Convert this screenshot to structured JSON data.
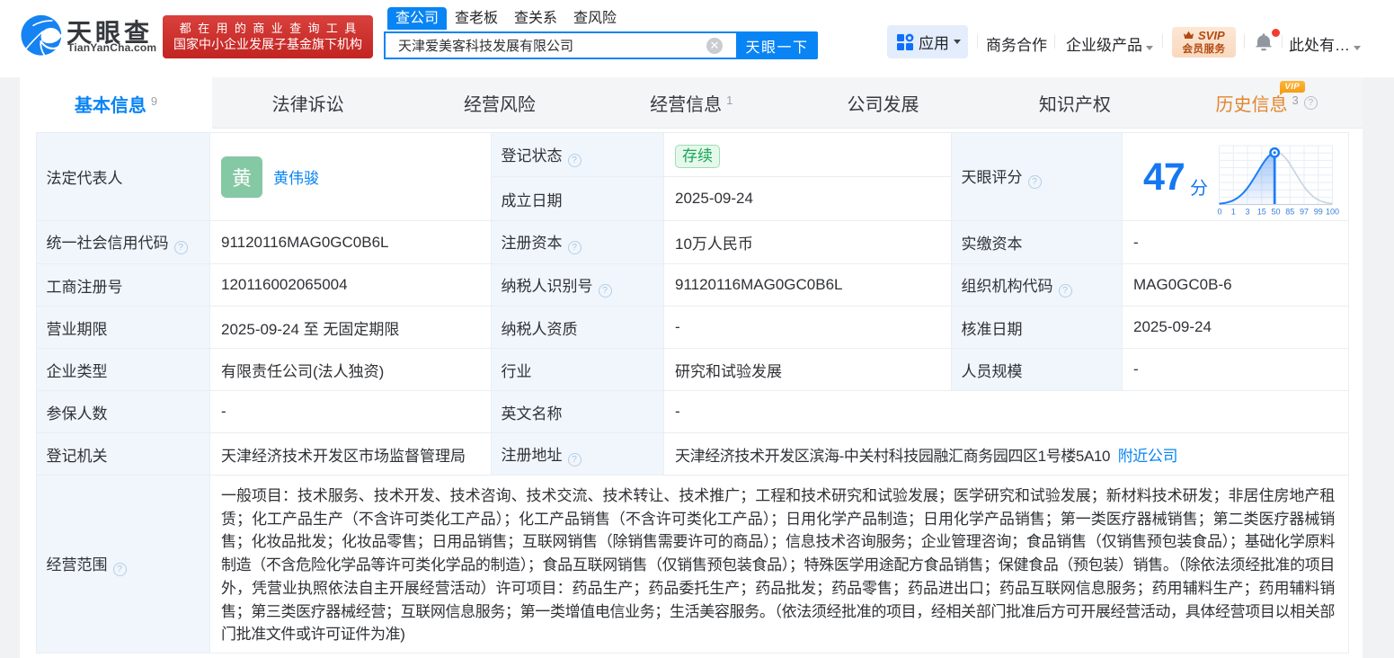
{
  "header": {
    "brand_cn": "天眼查",
    "brand_domain": "TianYanCha.com",
    "slogan_line1": "都在用的商业查询工具",
    "slogan_line2": "国家中小企业发展子基金旗下机构",
    "search": {
      "tabs": [
        {
          "label": "查公司"
        },
        {
          "label": "查老板"
        },
        {
          "label": "查关系"
        },
        {
          "label": "查风险"
        }
      ],
      "value": "天津爱美客科技发展有限公司",
      "button_label": "天眼一下"
    },
    "nav": {
      "apps": "应用",
      "business_coop": "商务合作",
      "enterprise_products": "企业级产品",
      "svip_line1": "SVIP",
      "svip_line2": "会员服务",
      "user": "此处有…"
    }
  },
  "tabs": [
    {
      "label": "基本信息",
      "count": "9"
    },
    {
      "label": "法律诉讼",
      "count": ""
    },
    {
      "label": "经营风险",
      "count": ""
    },
    {
      "label": "经营信息",
      "count": "1"
    },
    {
      "label": "公司发展",
      "count": ""
    },
    {
      "label": "知识产权",
      "count": ""
    },
    {
      "label": "历史信息",
      "count": "3",
      "vip": "VIP"
    }
  ],
  "info": {
    "legal_rep_label": "法定代表人",
    "legal_rep_avatar": "黄",
    "legal_rep_name": "黄伟骏",
    "reg_status_label": "登记状态",
    "reg_status": "存续",
    "est_date_label": "成立日期",
    "est_date": "2025-09-24",
    "score_label": "天眼评分",
    "score": "47",
    "score_unit": "分",
    "uscc_label": "统一社会信用代码",
    "uscc": "91120116MAG0GC0B6L",
    "reg_capital_label": "注册资本",
    "reg_capital": "10万人民币",
    "paid_capital_label": "实缴资本",
    "paid_capital": "-",
    "reg_no_label": "工商注册号",
    "reg_no": "120116002065004",
    "taxpayer_id_label": "纳税人识别号",
    "taxpayer_id": "91120116MAG0GC0B6L",
    "org_code_label": "组织机构代码",
    "org_code": "MAG0GC0B-6",
    "term_label": "营业期限",
    "term": "2025-09-24 至 无固定期限",
    "taxpayer_quality_label": "纳税人资质",
    "taxpayer_quality": "-",
    "approval_date_label": "核准日期",
    "approval_date": "2025-09-24",
    "company_type_label": "企业类型",
    "company_type": "有限责任公司(法人独资)",
    "industry_label": "行业",
    "industry": "研究和试验发展",
    "staff_size_label": "人员规模",
    "staff_size": "-",
    "insured_label": "参保人数",
    "insured": "-",
    "english_name_label": "英文名称",
    "english_name": "-",
    "reg_authority_label": "登记机关",
    "reg_authority": "天津经济技术开发区市场监督管理局",
    "address_label": "注册地址",
    "address": "天津经济技术开发区滨海-中关村科技园融汇商务园四区1号楼5A10",
    "nearby_link": "附近公司",
    "scope_label": "经营范围",
    "scope": "一般项目：技术服务、技术开发、技术咨询、技术交流、技术转让、技术推广；工程和技术研究和试验发展；医学研究和试验发展；新材料技术研发；非居住房地产租赁；化工产品生产（不含许可类化工产品）；化工产品销售（不含许可类化工产品）；日用化学产品制造；日用化学产品销售；第一类医疗器械销售；第二类医疗器械销售；化妆品批发；化妆品零售；日用品销售；互联网销售（除销售需要许可的商品）；信息技术咨询服务；企业管理咨询；食品销售（仅销售预包装食品）；基础化学原料制造（不含危险化学品等许可类化学品的制造）；食品互联网销售（仅销售预包装食品）；特殊医学用途配方食品销售；保健食品（预包装）销售。（除依法须经批准的项目外，凭营业执照依法自主开展经营活动）许可项目：药品生产；药品委托生产；药品批发；药品零售；药品进出口；药品互联网信息服务；药用辅料生产；药用辅料销售；第三类医疗器械经营；互联网信息服务；第一类增值电信业务；生活美容服务。（依法须经批准的项目，经相关部门批准后方可开展经营活动，具体经营项目以相关部门批准文件或许可证件为准)"
  },
  "score_chart": {
    "type": "area",
    "axis": [
      "0",
      "1",
      "3",
      "15",
      "50",
      "85",
      "97",
      "99",
      "100"
    ],
    "score_value": 47,
    "marker_color": "#1d7ef5"
  },
  "colors": {
    "accent_blue": "#0984f4",
    "score_blue": "#1577f2",
    "status_green": "#16a854",
    "history_orange": "#e2862f",
    "vip_gold": "#f59d13",
    "slogan_red": "#c8221f",
    "avatar_green": "#85c8a4",
    "label_cell_bg": "#f0f6fc"
  }
}
